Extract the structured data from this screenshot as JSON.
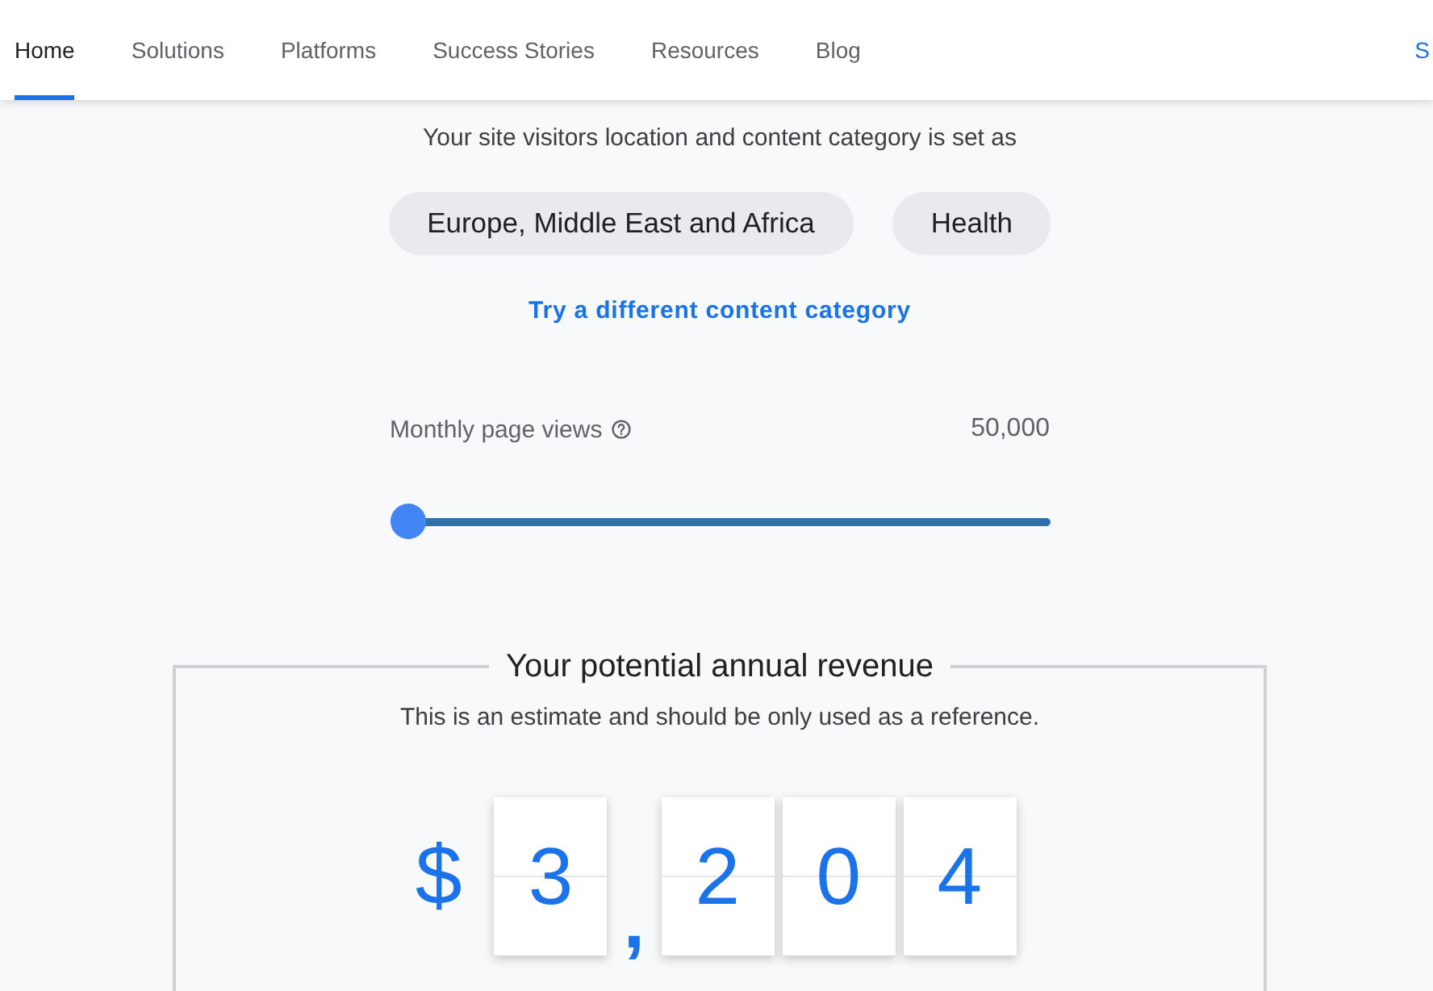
{
  "nav": {
    "tabs": [
      {
        "label": "Home",
        "selected": true
      },
      {
        "label": "Solutions",
        "selected": false
      },
      {
        "label": "Platforms",
        "selected": false
      },
      {
        "label": "Success Stories",
        "selected": false
      },
      {
        "label": "Resources",
        "selected": false
      },
      {
        "label": "Blog",
        "selected": false
      }
    ],
    "edge_link": "S"
  },
  "intro": "Your site visitors location and content category is set as",
  "chips": [
    "Europe, Middle East and Africa",
    "Health"
  ],
  "category_link": "Try a different content category",
  "page_views": {
    "label": "Monthly page views",
    "reading": "50,000",
    "level": 0
  },
  "revenue": {
    "title": "Your potential annual revenue",
    "note": "This is an estimate and should be only used as a reference.",
    "currency": "$",
    "figures": [
      {
        "kind": "digit",
        "text": "3"
      },
      {
        "kind": "separator",
        "text": ","
      },
      {
        "kind": "digit",
        "text": "2"
      },
      {
        "kind": "digit",
        "text": "0"
      },
      {
        "kind": "digit",
        "text": "4"
      }
    ]
  }
}
